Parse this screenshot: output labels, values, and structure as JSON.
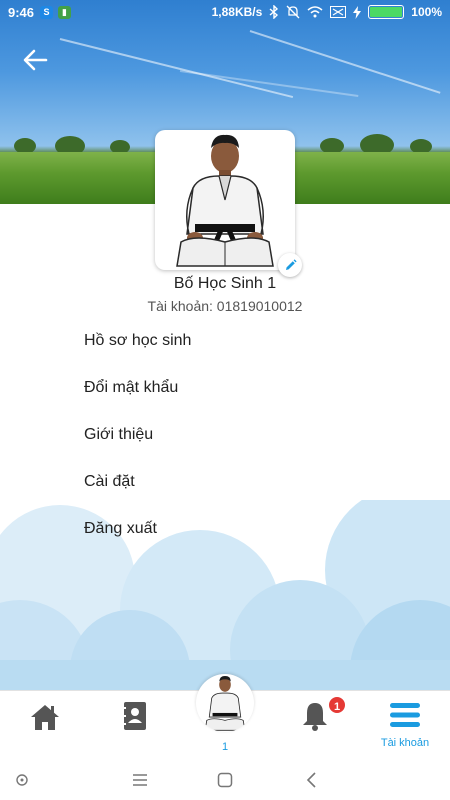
{
  "status_bar": {
    "time": "9:46",
    "network_speed": "1,88KB/s",
    "battery_percent": "100%",
    "battery_level": 1.0
  },
  "header": {
    "back_icon": "arrow-left-icon"
  },
  "profile": {
    "name": "Bố Học Sinh 1",
    "account": "Tài khoản: 01819010012"
  },
  "menu": {
    "items": [
      {
        "label": "Hồ sơ học sinh"
      },
      {
        "label": "Đổi mật khẩu"
      },
      {
        "label": "Giới thiệu"
      },
      {
        "label": "Cài đặt"
      },
      {
        "label": "Đăng xuất"
      }
    ]
  },
  "bottom_nav": {
    "items": [
      {
        "icon": "home-icon",
        "label": ""
      },
      {
        "icon": "contacts-book-icon",
        "label": ""
      },
      {
        "icon": "avatar",
        "label": "1"
      },
      {
        "icon": "bell-icon",
        "label": "",
        "badge": "1"
      },
      {
        "icon": "menu-icon",
        "label": "Tài khoản"
      }
    ],
    "active_index": 4
  },
  "colors": {
    "accent": "#1a9be0",
    "icon_gray": "#555555",
    "badge_red": "#e53935",
    "cloud_light": "#d6ecf8",
    "cloud_mid": "#b9dcf2"
  }
}
